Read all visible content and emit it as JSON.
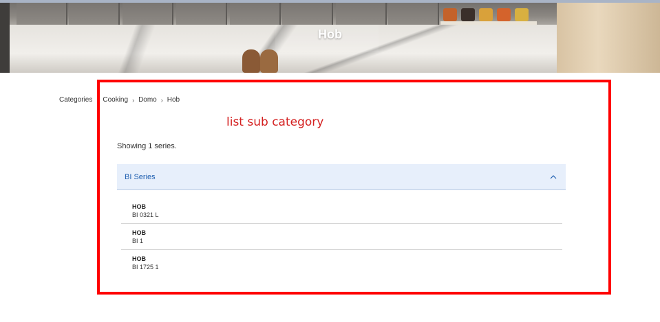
{
  "hero": {
    "title": "Hob"
  },
  "breadcrumb": {
    "items": [
      "Categories",
      "Cooking",
      "Domo",
      "Hob"
    ],
    "separator": "›"
  },
  "annotation": {
    "label": "list sub category",
    "color": "#ff0000"
  },
  "content": {
    "showing_text": "Showing 1 series.",
    "series": {
      "title": "BI Series",
      "expanded": true,
      "header_bg": "#e7effb",
      "title_color": "#1f5fb0",
      "icon": "chevron-up-icon",
      "products": [
        {
          "type": "HOB",
          "code": "BI 0321 L"
        },
        {
          "type": "HOB",
          "code": "BI 1"
        },
        {
          "type": "HOB",
          "code": "BI 1725 1"
        }
      ]
    }
  }
}
